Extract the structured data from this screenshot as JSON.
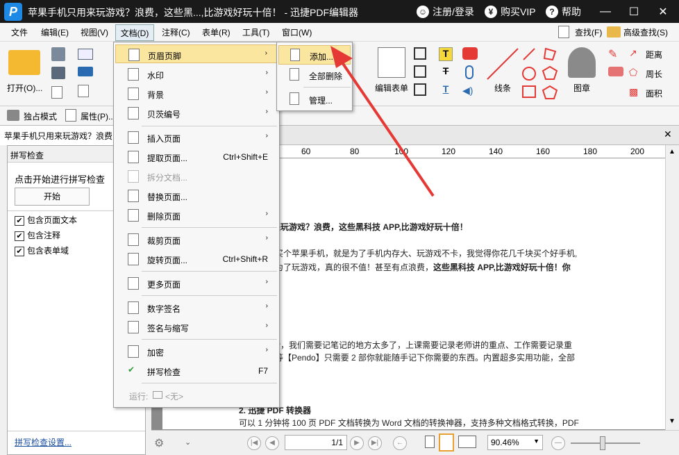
{
  "window": {
    "title": "苹果手机只用来玩游戏？浪费，这些黑...,比游戏好玩十倍！ - 迅捷PDF编辑器",
    "login": "注册/登录",
    "vip": "购买VIP",
    "help": "帮助",
    "logo": "P"
  },
  "menubar": {
    "items": [
      "文件",
      "编辑(E)",
      "视图(V)",
      "文档(D)",
      "注释(C)",
      "表单(R)",
      "工具(T)",
      "窗口(W)"
    ],
    "find": "查找(F)",
    "adv_find": "高级查找(S)"
  },
  "ribbon": {
    "open": "打开(O)...",
    "edit_form": "编辑表单",
    "line": "线条",
    "stamp": "图章",
    "distance": "距离",
    "perimeter": "周长",
    "area": "面积",
    "exclusive": "独占模式",
    "properties": "属性(P)..."
  },
  "doc_tab": {
    "label": "苹果手机只用来玩游戏？浪费"
  },
  "spell": {
    "title": "拼写检查",
    "prompt": "点击开始进行拼写检查",
    "start": "开始",
    "opt1": "包含页面文本",
    "opt2": "包含注释",
    "opt3": "包含表单域",
    "settings": "拼写检查设置..."
  },
  "ruler": {
    "ticks": [
      "60",
      "80",
      "100",
      "120",
      "140",
      "160",
      "180",
      "200"
    ]
  },
  "document": {
    "l1": "只用来玩游戏？浪费，这些黑科技 APP,比游戏好玩十倍！",
    "l2": "买个苹果手机，就是为了手机内存大、玩游戏不卡，我觉得你花几千块买个好手机,",
    "l3a": "为了玩游戏，真的很不值！甚至有点浪费，",
    "l3b": "这些黑科技 APP,比游戏好玩十倍！你",
    "l4": "P，我们需要记笔记的地方太多了，上课需要记录老师讲的重点、工作需要记录重",
    "l5": "等【Pendo】只需要 2 部你就能随手记下你需要的东西。内置超多实用功能，全部",
    "l6": "2.  迅捷 PDF 转换器",
    "l7": "可以 1 分钟将 100 页 PDF 文档转换为 Word 文档的转换神器，支持多种文档格式转换，PDF"
  },
  "statusbar": {
    "page": "1/1",
    "zoom": "90.46%"
  },
  "doc_menu": {
    "items": [
      {
        "label": "页眉页脚",
        "shortcut": "",
        "arrow": "›"
      },
      {
        "label": "水印",
        "shortcut": "",
        "arrow": "›"
      },
      {
        "label": "背景",
        "shortcut": "",
        "arrow": "›"
      },
      {
        "label": "贝茨编号",
        "shortcut": "",
        "arrow": "›"
      },
      {
        "label": "插入页面",
        "shortcut": "",
        "arrow": "›"
      },
      {
        "label": "提取页面...",
        "shortcut": "Ctrl+Shift+E",
        "arrow": ""
      },
      {
        "label": "拆分文档...",
        "shortcut": "",
        "arrow": ""
      },
      {
        "label": "替换页面...",
        "shortcut": "",
        "arrow": ""
      },
      {
        "label": "删除页面",
        "shortcut": "",
        "arrow": "›"
      },
      {
        "label": "裁剪页面",
        "shortcut": "",
        "arrow": "›"
      },
      {
        "label": "旋转页面...",
        "shortcut": "Ctrl+Shift+R",
        "arrow": ""
      },
      {
        "label": "更多页面",
        "shortcut": "",
        "arrow": "›"
      },
      {
        "label": "数字签名",
        "shortcut": "",
        "arrow": "›"
      },
      {
        "label": "签名与缩写",
        "shortcut": "",
        "arrow": "›"
      },
      {
        "label": "加密",
        "shortcut": "",
        "arrow": "›"
      },
      {
        "label": "拼写检查",
        "shortcut": "F7",
        "arrow": ""
      }
    ],
    "run_label": "运行:",
    "run_value": "<无>"
  },
  "submenu": {
    "items": [
      "添加...",
      "全部删除",
      "管理..."
    ]
  },
  "colors": {
    "accent": "#1e88e5",
    "arrow": "#e53935",
    "highlight": "#fbe6a0"
  }
}
